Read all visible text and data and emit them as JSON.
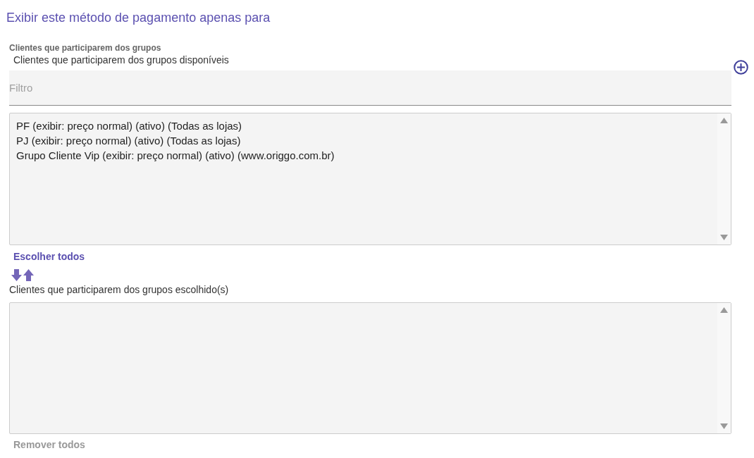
{
  "title": "Exibir este método de pagamento apenas para",
  "field_label": "Clientes que participarem dos grupos",
  "available": {
    "label": "Clientes que participarem dos grupos disponíveis",
    "filter": {
      "placeholder": "Filtro"
    },
    "items": [
      {
        "label": "PF (exibir: preço normal) (ativo) (Todas as lojas)"
      },
      {
        "label": "PJ (exibir: preço normal) (ativo) (Todas as lojas)"
      },
      {
        "label": "Grupo Cliente Vip (exibir: preço normal) (ativo) (www.origgo.com.br)"
      }
    ],
    "action": {
      "label": "Escolher todos",
      "disabled": false
    }
  },
  "chosen": {
    "label": "Clientes que participarem dos grupos escolhido(s)",
    "action": {
      "label": "Remover todos",
      "disabled": true
    }
  }
}
